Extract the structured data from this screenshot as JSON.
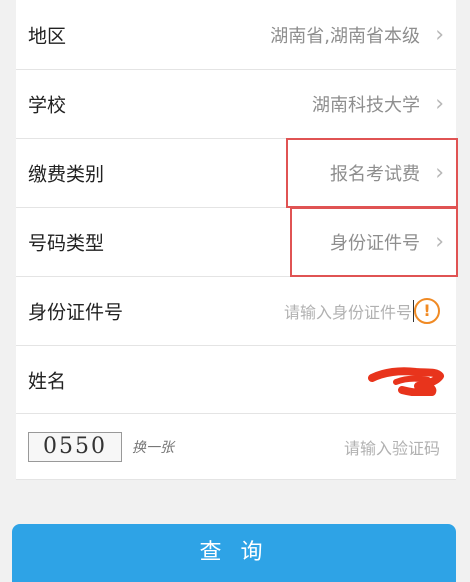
{
  "form": {
    "region": {
      "label": "地区",
      "value": "湖南省,湖南省本级"
    },
    "school": {
      "label": "学校",
      "value": "湖南科技大学"
    },
    "fee_type": {
      "label": "缴费类别",
      "value": "报名考试费"
    },
    "id_type": {
      "label": "号码类型",
      "value": "身份证件号"
    },
    "id_number": {
      "label": "身份证件号",
      "placeholder": "请输入身份证件号"
    },
    "name": {
      "label": "姓名"
    },
    "captcha": {
      "code": "0550",
      "refresh_label": "换一张",
      "placeholder": "请输入验证码"
    }
  },
  "submit_label": "查 询",
  "colors": {
    "accent": "#2ea3e6",
    "highlight": "#e05353",
    "warning": "#f08a24",
    "redaction": "#e8341c"
  }
}
